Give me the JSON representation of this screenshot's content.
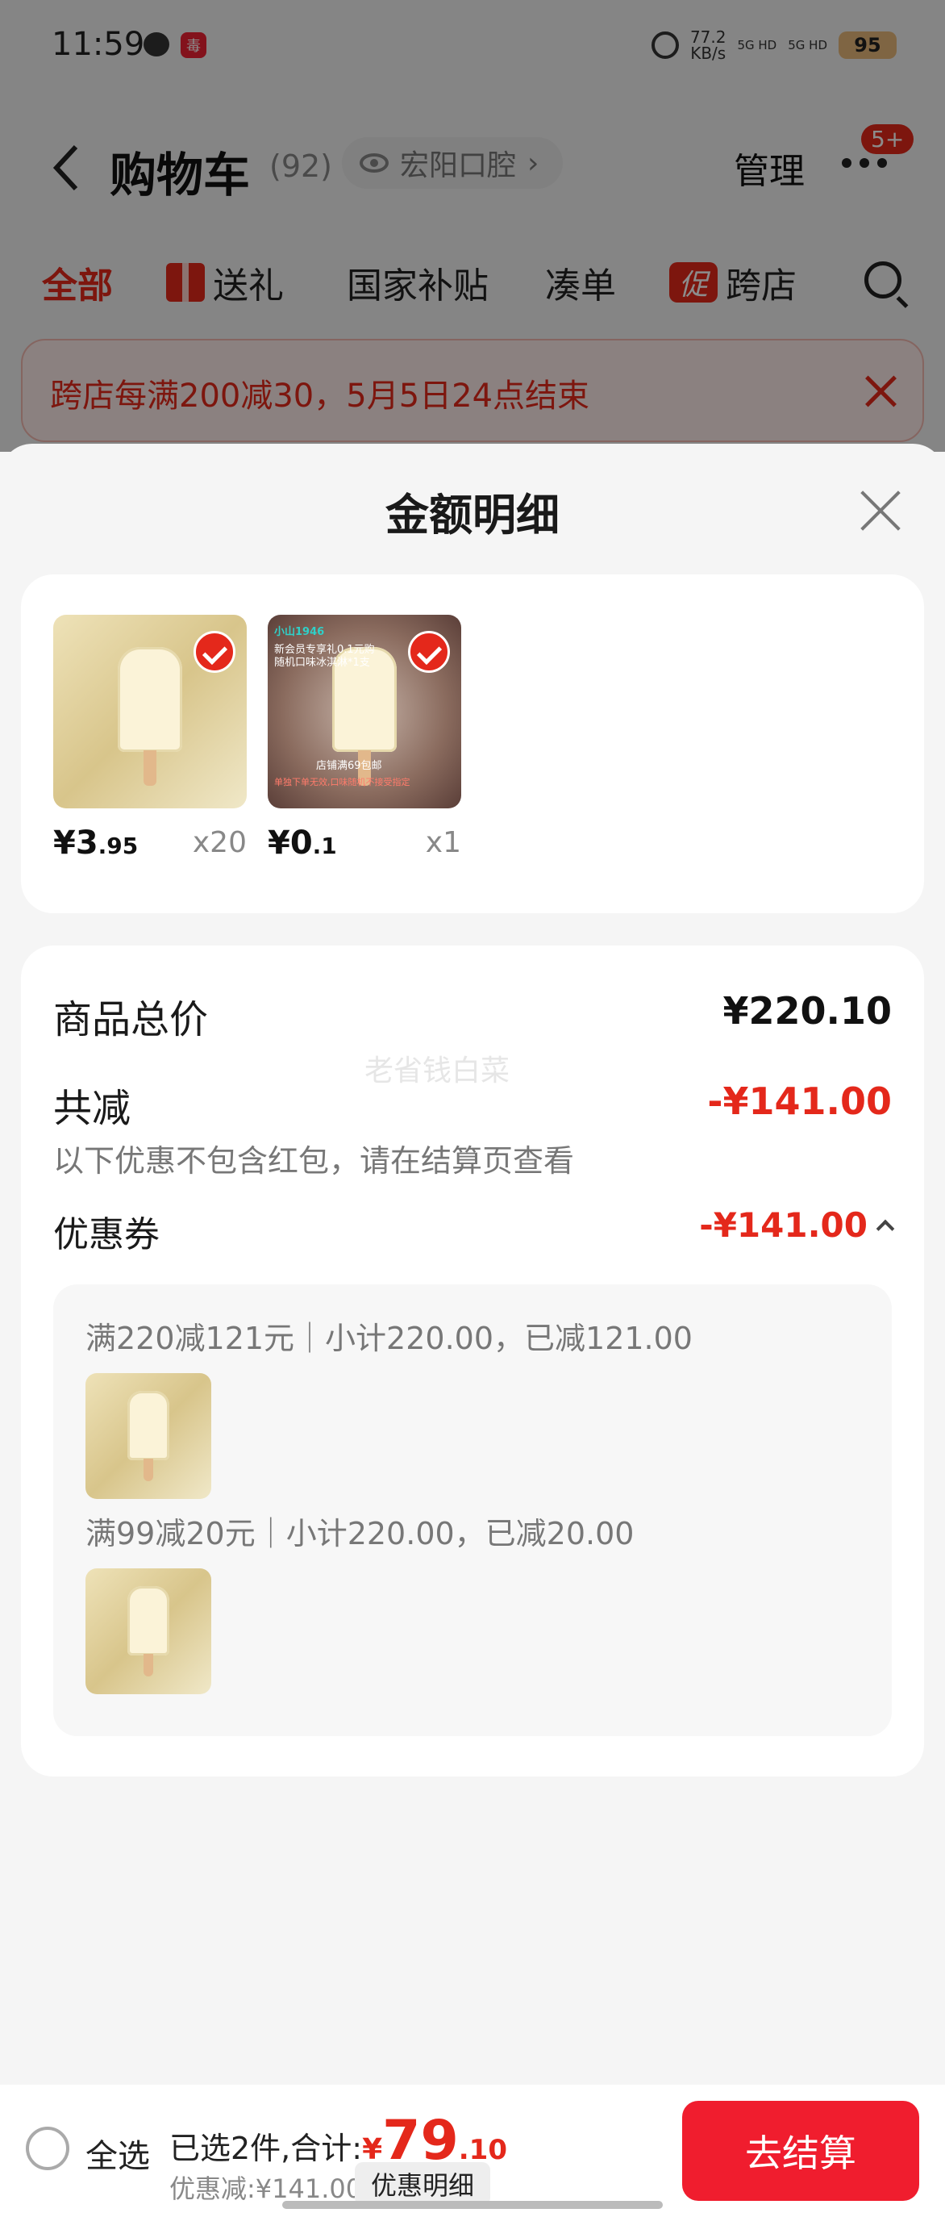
{
  "status_bar": {
    "time": "11:59",
    "app_badge": "毒",
    "speed": "77.2\nKB/s",
    "signal1": "5G HD",
    "signal2": "5G HD",
    "battery": "95"
  },
  "nav": {
    "title": "购物车",
    "count": "(92)",
    "shop": "宏阳口腔",
    "shop_chevron": "›",
    "manage": "管理",
    "more_badge": "5+"
  },
  "tabs": [
    {
      "label": "全部"
    },
    {
      "label": "送礼"
    },
    {
      "label": "国家补贴"
    },
    {
      "label": "凑单"
    },
    {
      "label": "跨店"
    }
  ],
  "promo_icon": "促",
  "banner": {
    "text": "跨店每满200减30，5月5日24点结束"
  },
  "sheet": {
    "title": "金额明细",
    "watermark": "老省钱白菜",
    "products": [
      {
        "price_int": "¥3",
        "price_dec": ".95",
        "qty": "x20"
      },
      {
        "price_int": "¥0",
        "price_dec": ".1",
        "qty": "x1",
        "promo_lines": [
          "小山1946",
          "新会员专享礼0.1元购",
          "随机口味冰淇淋*1支",
          "店铺满69包邮",
          "单独下单无效,口味随机不接受指定"
        ]
      }
    ],
    "total_label": "商品总价",
    "total_value": "¥220.10",
    "reduce_label": "共减",
    "reduce_value": "-¥141.00",
    "reduce_note": "以下优惠不包含红包，请在结算页查看",
    "coupon_label": "优惠券",
    "coupon_value": "-¥141.00",
    "coupon_rules": [
      {
        "text": "满220减121元｜小计220.00，已减121.00"
      },
      {
        "text": "满99减20元｜小计220.00，已减20.00"
      }
    ]
  },
  "bottom": {
    "select_all": "全选",
    "summary_prefix": "已选2件,合计:",
    "currency": "¥",
    "amount_int": "79",
    "amount_dec": ".10",
    "discount": "优惠减:¥141.00",
    "detail_button": "优惠明细",
    "checkout": "去结算"
  },
  "colors": {
    "accent": "#e4281b",
    "checkout": "#f01d2e"
  }
}
